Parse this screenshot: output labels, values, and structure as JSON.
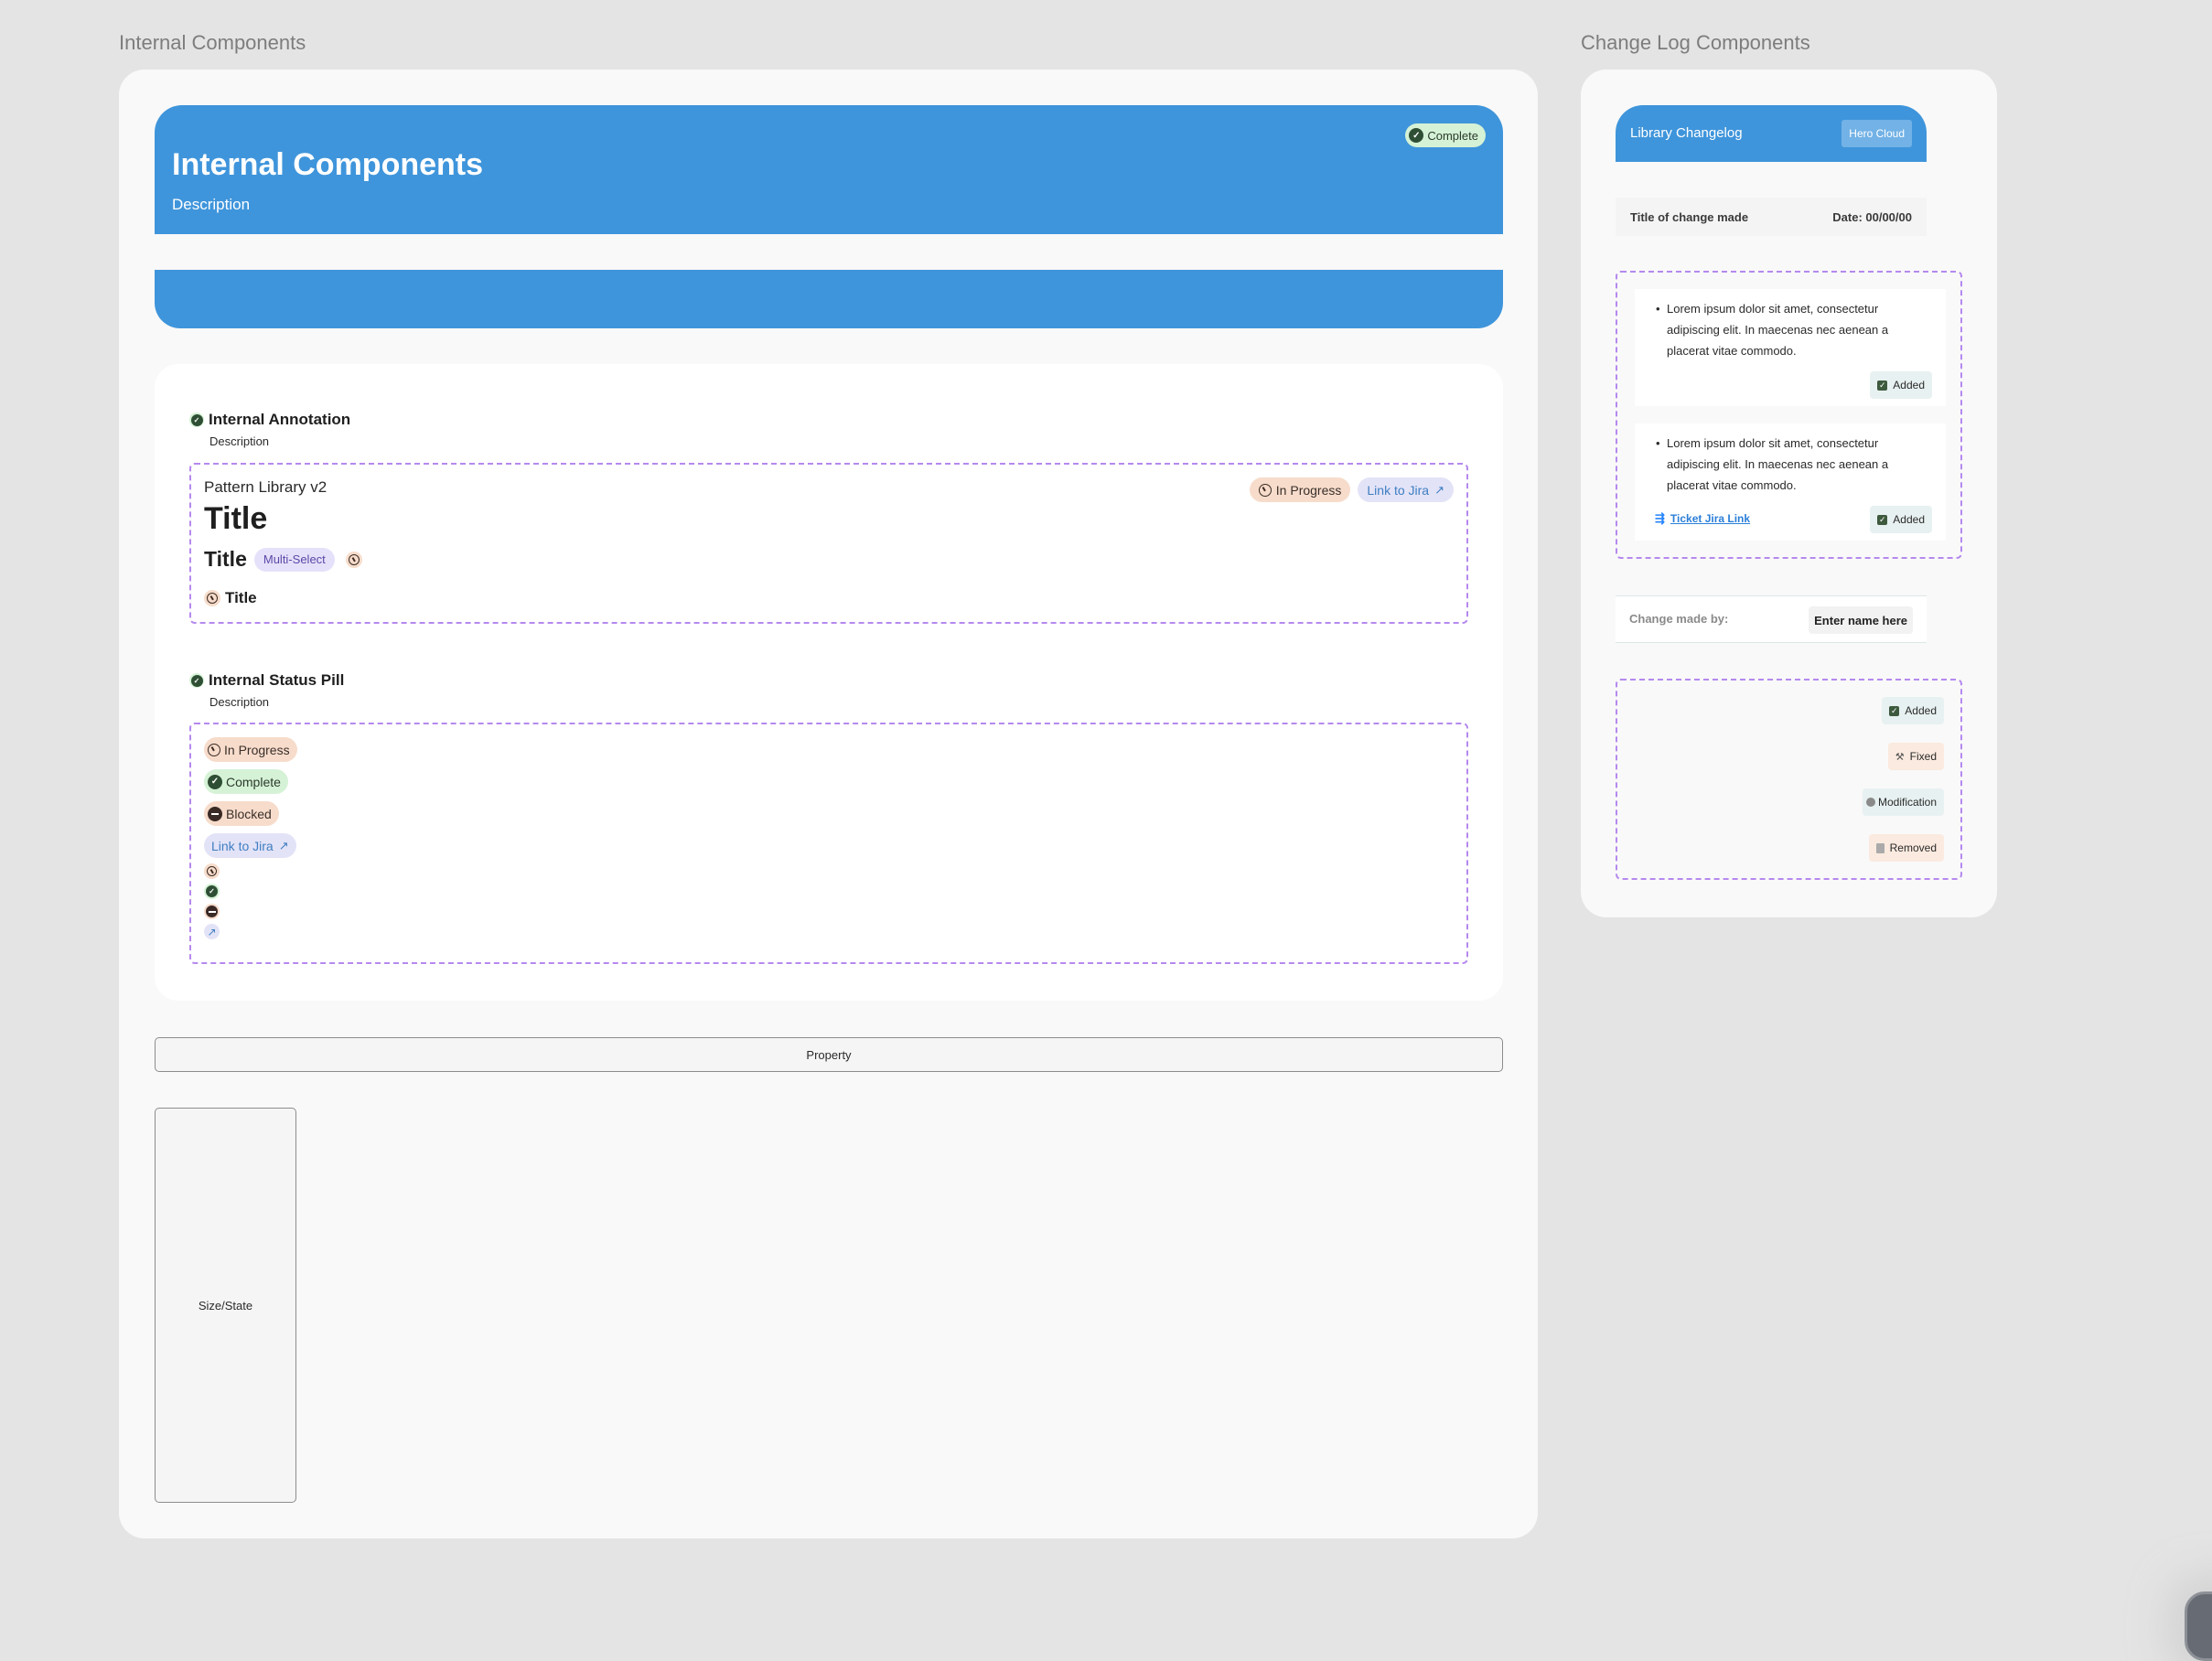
{
  "left_frame": {
    "label": "Internal Components",
    "header": {
      "title": "Internal Components",
      "description": "Description",
      "status": "Complete"
    },
    "annotation_section": {
      "title": "Internal Annotation",
      "description": "Description",
      "example": {
        "library": "Pattern Library v2",
        "title_large": "Title",
        "title_medium": "Title",
        "multi_select": "Multi-Select",
        "title_small": "Title",
        "status": "In Progress",
        "jira_link": "Link to Jira"
      }
    },
    "status_pill_section": {
      "title": "Internal Status Pill",
      "description": "Description",
      "pills": [
        {
          "label": "In Progress",
          "icon": "clock-icon"
        },
        {
          "label": "Complete",
          "icon": "check-circle-icon"
        },
        {
          "label": "Blocked",
          "icon": "blocked-icon"
        },
        {
          "label": "Link to Jira",
          "icon": "external-link-icon"
        }
      ],
      "icon_only": [
        "clock-icon",
        "check-circle-icon",
        "blocked-icon",
        "external-link-icon"
      ]
    },
    "property_label": "Property",
    "size_state_label": "Size/State"
  },
  "right_frame": {
    "label": "Change Log Components",
    "header": {
      "title": "Library Changelog",
      "badge": "Hero Cloud"
    },
    "change_row": {
      "title": "Title of change made",
      "date": "Date: 00/00/00"
    },
    "entries": [
      {
        "text": "Lorem ipsum dolor sit amet, consectetur adipiscing elit. In maecenas nec aenean a placerat vitae commodo.",
        "tag": "Added",
        "link": null
      },
      {
        "text": "Lorem ipsum dolor sit amet, consectetur adipiscing elit. In maecenas nec aenean a placerat vitae commodo.",
        "tag": "Added",
        "link": "Ticket Jira Link"
      }
    ],
    "author": {
      "label": "Change made by:",
      "value": "Enter name here"
    },
    "tags": [
      {
        "label": "Added",
        "icon": "checkbox-icon",
        "bg": "#e8f1f1"
      },
      {
        "label": "Fixed",
        "icon": "hammer-icon",
        "bg": "#fbeadf"
      },
      {
        "label": "Modification",
        "icon": "globe-icon",
        "bg": "#e8f1f1"
      },
      {
        "label": "Removed",
        "icon": "trash-icon",
        "bg": "#fbeadf"
      }
    ]
  },
  "colors": {
    "brand_blue": "#3f95db",
    "dashed_border": "#b589ee",
    "complete_bg": "#d5f2d6",
    "progress_bg": "#f7dccb",
    "jira_bg": "#e3e3f8"
  }
}
